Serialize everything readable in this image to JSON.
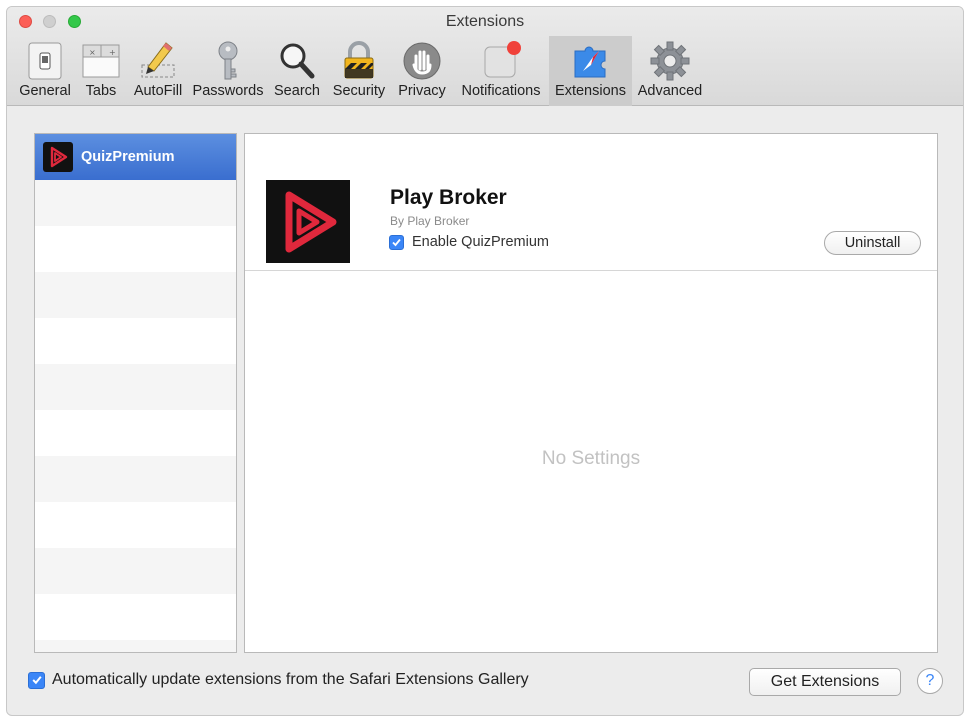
{
  "window": {
    "title": "Extensions"
  },
  "toolbar": {
    "items": [
      {
        "label": "General",
        "icon": "general-switch-icon"
      },
      {
        "label": "Tabs",
        "icon": "tabs-icon"
      },
      {
        "label": "AutoFill",
        "icon": "pencil-icon"
      },
      {
        "label": "Passwords",
        "icon": "key-icon"
      },
      {
        "label": "Search",
        "icon": "search-icon"
      },
      {
        "label": "Security",
        "icon": "lock-icon"
      },
      {
        "label": "Privacy",
        "icon": "hand-icon"
      },
      {
        "label": "Notifications",
        "icon": "notification-icon"
      },
      {
        "label": "Extensions",
        "icon": "puzzle-compass-icon",
        "selected": true
      },
      {
        "label": "Advanced",
        "icon": "gear-icon"
      }
    ]
  },
  "sidebar": {
    "items": [
      {
        "name": "QuizPremium",
        "selected": true
      }
    ]
  },
  "extension": {
    "title": "Play Broker",
    "by": "By Play Broker",
    "enable_label": "Enable QuizPremium",
    "enabled": true,
    "uninstall_label": "Uninstall",
    "no_settings": "No Settings"
  },
  "footer": {
    "auto_update_label": "Automatically update extensions from the Safari Extensions Gallery",
    "auto_update_checked": true,
    "get_extensions_label": "Get Extensions",
    "help_label": "?"
  },
  "colors": {
    "accent": "#3b86f7",
    "selection": "#3a6ecf",
    "logo_red": "#e0283c"
  }
}
